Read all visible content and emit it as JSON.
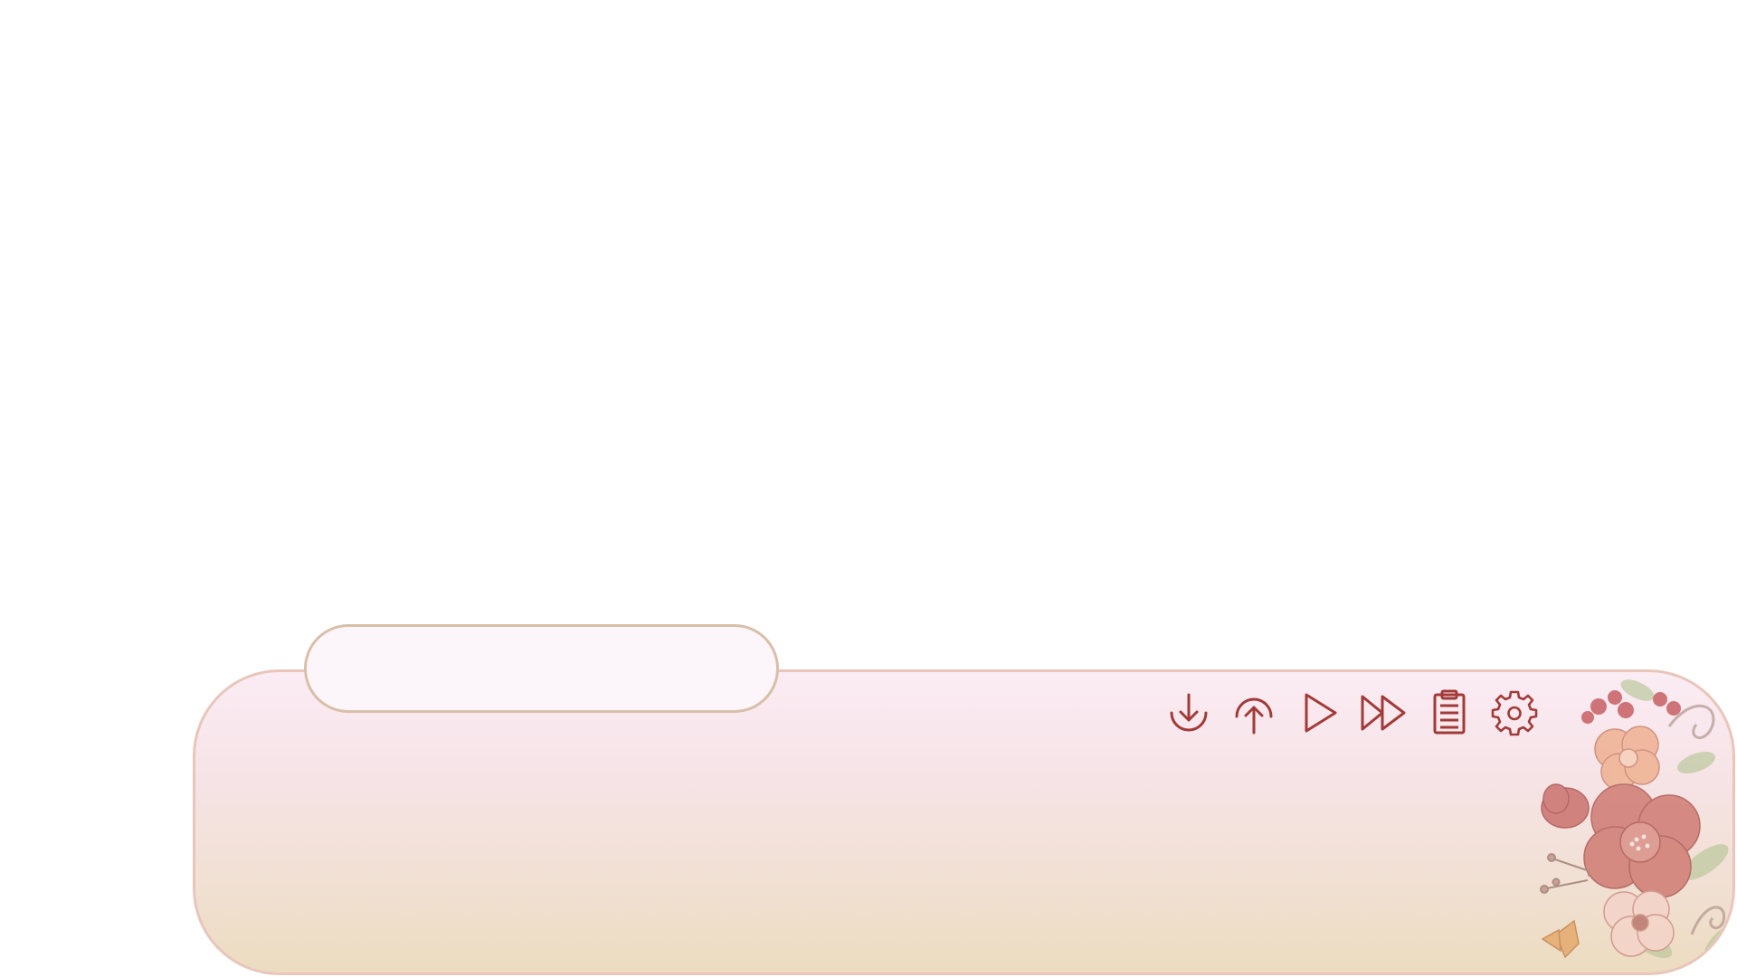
{
  "namebox": {
    "speaker": ""
  },
  "dialogue": {
    "text": ""
  },
  "quick_menu": {
    "buttons": [
      {
        "id": "load",
        "icon": "download-icon"
      },
      {
        "id": "save",
        "icon": "upload-icon"
      },
      {
        "id": "auto",
        "icon": "play-icon"
      },
      {
        "id": "skip",
        "icon": "fast-forward-icon"
      },
      {
        "id": "history",
        "icon": "clipboard-icon"
      },
      {
        "id": "settings",
        "icon": "gear-icon"
      }
    ]
  },
  "colors": {
    "icon": "#a23a38",
    "box_border": "#e8c6bb",
    "namebox_border": "#d8bfa9",
    "box_gradient_top": "#fbecf4",
    "box_gradient_bottom": "#ecdcc0"
  }
}
